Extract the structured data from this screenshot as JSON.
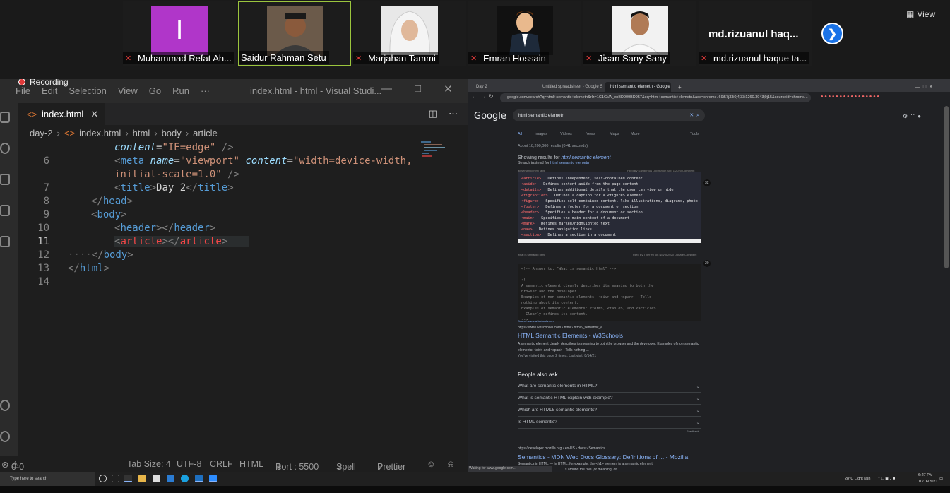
{
  "participants": [
    {
      "name": "Muhammad Refat Ah...",
      "avatar_letter": "I",
      "muted": true
    },
    {
      "name": "Saidur Rahman Setu",
      "muted": false,
      "active_speaker": true
    },
    {
      "name": "Marjahan Tammi",
      "muted": true
    },
    {
      "name": "Emran Hossain",
      "muted": true
    },
    {
      "name": "Jisan Sany Sany",
      "muted": true
    },
    {
      "name": "md.rizuanul haque ta...",
      "display_name": "md.rizuanul  haq...",
      "muted": true
    }
  ],
  "meeting": {
    "view_label": "View",
    "recording_label": "Recording"
  },
  "vscode": {
    "menu": [
      "File",
      "Edit",
      "Selection",
      "View",
      "Go",
      "Run",
      "···"
    ],
    "window_title": "index.html - html - Visual Studi...",
    "tab_label": "index.html",
    "breadcrumbs": [
      "day-2",
      "index.html",
      "html",
      "body",
      "article"
    ],
    "line_numbers": [
      "",
      "6",
      "",
      "7",
      "8",
      "9",
      "10",
      "11",
      "12",
      "13",
      "14"
    ],
    "current_line": "11",
    "status": {
      "errors": "0",
      "warnings": "0",
      "tab_size": "Tab Size: 4",
      "encoding": "UTF-8",
      "eol": "CRLF",
      "language": "HTML",
      "port": "Port : 5500",
      "spell": "Spell",
      "prettier": "Prettier"
    }
  },
  "browser": {
    "tabs": [
      "Day 2",
      "Untitled spreadsheet - Google S",
      "html semantic elemetn - Google"
    ],
    "url": "google.com/search?q=html+semantic+elemetn&rlz=1C1GVA_enBD909BD957&oq=html+semantic+elemetn&aqs=chrome..69i57j33i0j4j33i1260.3943j0j15&sourceid=chrome...",
    "google_logo": "Google",
    "search_query": "html semantic elemetn",
    "search_tabs": [
      "All",
      "Images",
      "Videos",
      "News",
      "Maps",
      "More",
      "Tools"
    ],
    "result_stats": "About 18,200,000 results (0.41 seconds)",
    "showing_results": "Showing results for",
    "corrected_query": "html semantic element",
    "search_instead_prefix": "Search instead for",
    "search_instead_query": "html semantic elemetn",
    "snippet_head_left": "all semantic html tags",
    "snippet_head_right": "Filed By Dangerous Dogfish on Sep 1 2020 Comment",
    "snippet_lines": [
      {
        "tag": "<article>",
        "text": "Defines independent, self-contained content"
      },
      {
        "tag": "<aside>",
        "text": "Defines content aside from the page content"
      },
      {
        "tag": "<details>",
        "text": "Defines additional details that the user can view or hide"
      },
      {
        "tag": "<figcaption>",
        "text": "Defines a caption for a <figure> element"
      },
      {
        "tag": "<figure>",
        "text": "Specifies self-contained content, like illustrations, diagrams, photo"
      },
      {
        "tag": "<footer>",
        "text": "Defines a footer for a document or section"
      },
      {
        "tag": "<header>",
        "text": "Specifies a header for a document or section"
      },
      {
        "tag": "<main>",
        "text": "Specifies the main content of a document"
      },
      {
        "tag": "<mark>",
        "text": "Defines marked/highlighted text"
      },
      {
        "tag": "<nav>",
        "text": "Defines navigation links"
      },
      {
        "tag": "<section>",
        "text": "Defines a section in a document"
      }
    ],
    "snippet_badge_1": "32",
    "snippet2_head_left": "what is semantic html",
    "snippet2_head_right": "Filed By Tiger HT on Nov 5 2020 Donate Comment",
    "snippet2_lines": [
      "<!-- Answer to: \"What is semantic html\" -->",
      "",
      "<!--",
      "  A semantic element clearly describes its meaning to both the",
      "  browser and the developer.",
      "  Examples of non-semantic elements: <div> and <span> - Tells",
      "  nothing about its content.",
      "  Examples of semantic elements: <form>, <table>, and <article>",
      "  - Clearly defines its content.",
      "-->"
    ],
    "snippet_badge_2": "20",
    "source_label": "Source: www.w3schools.com",
    "result1": {
      "cite": "https://www.w3schools.com › html › html5_semantic_e...",
      "title": "HTML Semantic Elements - W3Schools",
      "desc": "A semantic element clearly describes its meaning to both the browser and the developer. Examples of non-semantic elements: <div> and <span> - Tells nothing ...",
      "visited": "You've visited this page 2 times. Last visit: 8/14/21"
    },
    "people_also_ask": "People also ask",
    "questions": [
      "What are semantic elements in HTML?",
      "What is semantic HTML explain with example?",
      "Which are HTML5 semantic elements?",
      "Is HTML semantic?"
    ],
    "feedback": "Feedback",
    "result2": {
      "cite": "https://developer.mozilla.org › en-US › docs › Semantics",
      "title": "Semantics - MDN Web Docs Glossary: Definitions of ... - Mozilla",
      "desc": "Semantics in HTML — In HTML, for example, the <h1> element is a semantic element,",
      "desc2": "s around the role (or meaning) of ..."
    },
    "status_text": "Waiting for www.google.com..."
  },
  "taskbar": {
    "search_placeholder": "Type here to search",
    "weather": "28°C  Light rain",
    "time": "6:27 PM",
    "date": "10/16/2021"
  }
}
